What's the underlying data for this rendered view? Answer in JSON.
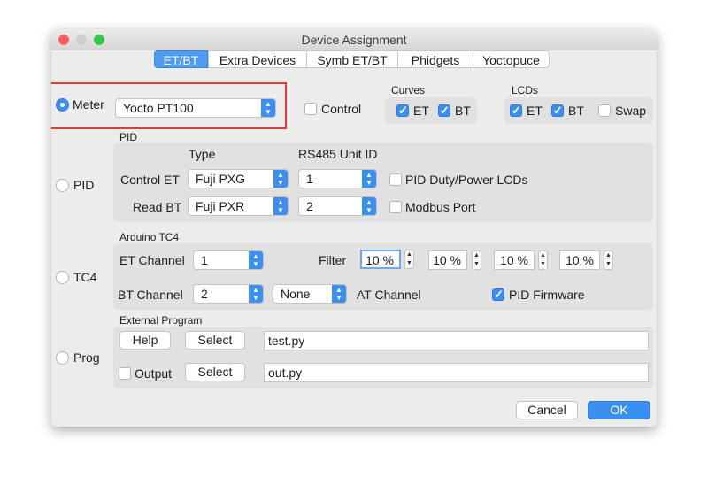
{
  "window": {
    "title": "Device Assignment"
  },
  "tabs": [
    "ET/BT",
    "Extra Devices",
    "Symb ET/BT",
    "Phidgets",
    "Yoctopuce"
  ],
  "radios": {
    "meter": "Meter",
    "pid": "PID",
    "tc4": "TC4",
    "prog": "Prog"
  },
  "meter": {
    "combo_value": "Yocto PT100"
  },
  "control": {
    "label": "Control"
  },
  "curves": {
    "title": "Curves",
    "et": "ET",
    "bt": "BT"
  },
  "lcds": {
    "title": "LCDs",
    "et": "ET",
    "bt": "BT",
    "swap": "Swap"
  },
  "pid": {
    "title": "PID",
    "type_header": "Type",
    "unit_header": "RS485 Unit ID",
    "control_et_label": "Control ET",
    "read_bt_label": "Read BT",
    "control_et_type": "Fuji PXG",
    "read_bt_type": "Fuji PXR",
    "control_et_unit": "1",
    "read_bt_unit": "2",
    "duty_lcds": "PID Duty/Power LCDs",
    "modbus_port": "Modbus Port"
  },
  "tc4": {
    "title": "Arduino TC4",
    "et_channel_label": "ET Channel",
    "et_channel_value": "1",
    "bt_channel_label": "BT Channel",
    "bt_channel_value": "2",
    "at_channel_value": "None",
    "at_channel_label": "AT Channel",
    "filter_label": "Filter",
    "filters": [
      "10 %",
      "10 %",
      "10 %",
      "10 %"
    ],
    "pid_firmware": "PID Firmware"
  },
  "prog": {
    "title": "External Program",
    "help": "Help",
    "select1": "Select",
    "program": "test.py",
    "output": "Output",
    "select2": "Select",
    "output_file": "out.py"
  },
  "buttons": {
    "cancel": "Cancel",
    "ok": "OK"
  },
  "colors": {
    "accent": "#3a8ff1",
    "highlight": "#e53935"
  }
}
